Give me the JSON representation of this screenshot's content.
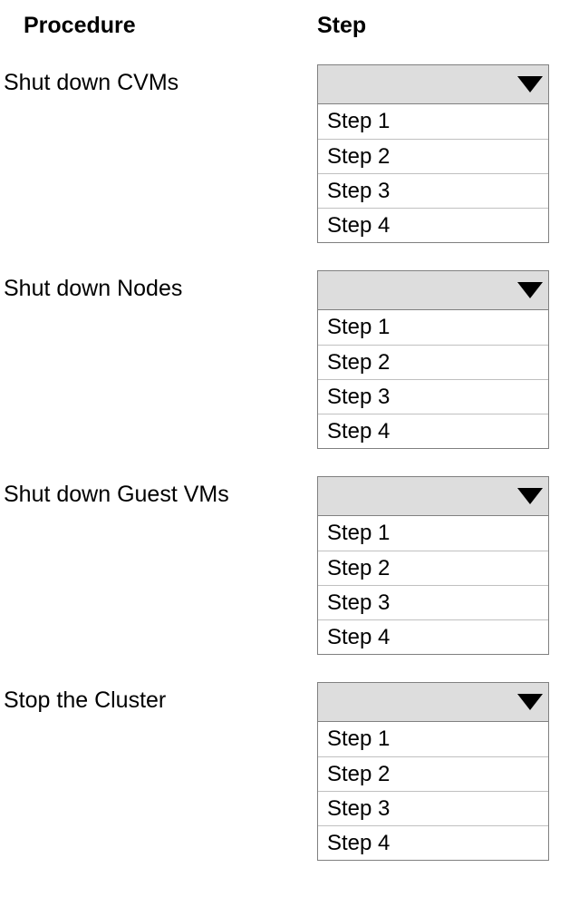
{
  "headers": {
    "procedure": "Procedure",
    "step": "Step"
  },
  "procedures": [
    {
      "label": "Shut  down CVMs",
      "options": [
        "Step 1",
        "Step 2",
        "Step 3",
        "Step 4"
      ]
    },
    {
      "label": "Shut down Nodes",
      "options": [
        "Step 1",
        "Step 2",
        "Step 3",
        "Step 4"
      ]
    },
    {
      "label": "Shut down Guest VMs",
      "options": [
        "Step 1",
        "Step 2",
        "Step 3",
        "Step 4"
      ]
    },
    {
      "label": "Stop the Cluster",
      "options": [
        "Step 1",
        "Step 2",
        "Step 3",
        "Step 4"
      ]
    }
  ]
}
